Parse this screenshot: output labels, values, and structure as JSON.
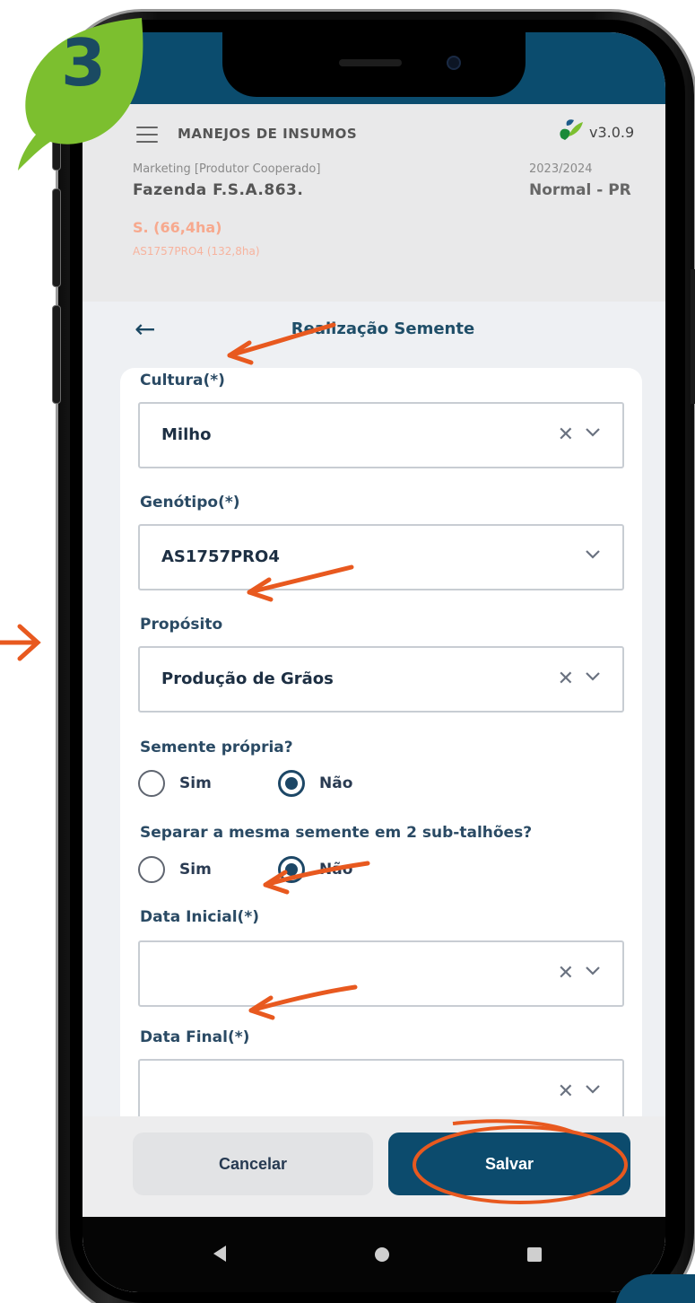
{
  "step": {
    "number": "3",
    "leaf_color": "#7cbf2f"
  },
  "accent_color": "#e8591f",
  "app": {
    "title": "MANEJOS DE INSUMOS",
    "version": "v3.0.9",
    "profile_label": "Marketing [Produtor Cooperado]",
    "farm_name": "Fazenda F.S.A.863.",
    "season": "2023/2024",
    "region": "Normal - PR",
    "area_main": "S. (66,4ha)",
    "area_sub": "AS1757PRO4 (132,8ha)"
  },
  "page": {
    "title": "Realização Semente"
  },
  "form": {
    "cultura": {
      "label": "Cultura(*)",
      "value": "Milho"
    },
    "genotipo": {
      "label": "Genótipo(*)",
      "value": "AS1757PRO4"
    },
    "proposito": {
      "label": "Propósito",
      "value": "Produção de Grãos"
    },
    "semente_propria": {
      "label": "Semente própria?",
      "options": [
        "Sim",
        "Não"
      ],
      "selected": "Não"
    },
    "separar": {
      "label": "Separar a mesma semente em 2 sub-talhões?",
      "options": [
        "Sim",
        "Não"
      ],
      "selected": "Não"
    },
    "data_inicial": {
      "label": "Data Inicial(*)",
      "value": ""
    },
    "data_final": {
      "label": "Data Final(*)",
      "value": ""
    },
    "clear_glyph": "✕"
  },
  "footer": {
    "cancel_label": "Cancelar",
    "save_label": "Salvar"
  },
  "icons": {
    "menu": "hamburger-icon",
    "back": "arrow-left-icon",
    "clear": "close-icon",
    "dropdown": "chevron-down-icon",
    "logo": "sementes-logo-icon"
  },
  "arrow_glyph": "←"
}
